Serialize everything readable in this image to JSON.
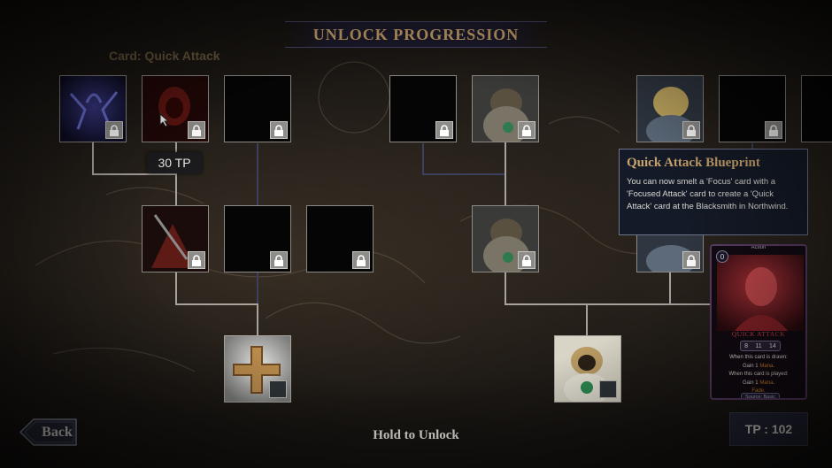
{
  "header": {
    "title": "UNLOCK PROGRESSION"
  },
  "tree": {
    "label": "Card: Quick Attack"
  },
  "tp_tooltip": "30 TP",
  "info_panel": {
    "title": "Quick Attack Blueprint",
    "body": "You can now smelt a 'Focus' card with a 'Focused Attack' card to create a 'Quick Attack' card at the Blacksmith in Northwind."
  },
  "card": {
    "type": "Action",
    "cost": "0",
    "name": "QUICK ATTACK",
    "stats": [
      "8",
      "11",
      "14"
    ],
    "line1": "When this card is drawn:",
    "line2_pre": "Gain 1 ",
    "line2_kw": "Mana",
    "line2_post": ".",
    "line3": "When this card is played:",
    "line4_pre": "Gain 1 ",
    "line4_kw": "Mana",
    "line4_post": ".",
    "line5": "Fade.",
    "footer": "Source: Basic"
  },
  "footer": {
    "back_label": "Back",
    "hold_label": "Hold to Unlock",
    "tp_label": "TP : 102"
  },
  "icons": [
    "lock-icon",
    "plus-icon",
    "back-arrow-icon",
    "cursor-icon"
  ],
  "colors": {
    "gold": "#c9a46a",
    "line": "#a7a29b",
    "card_border": "#5b3d66"
  }
}
